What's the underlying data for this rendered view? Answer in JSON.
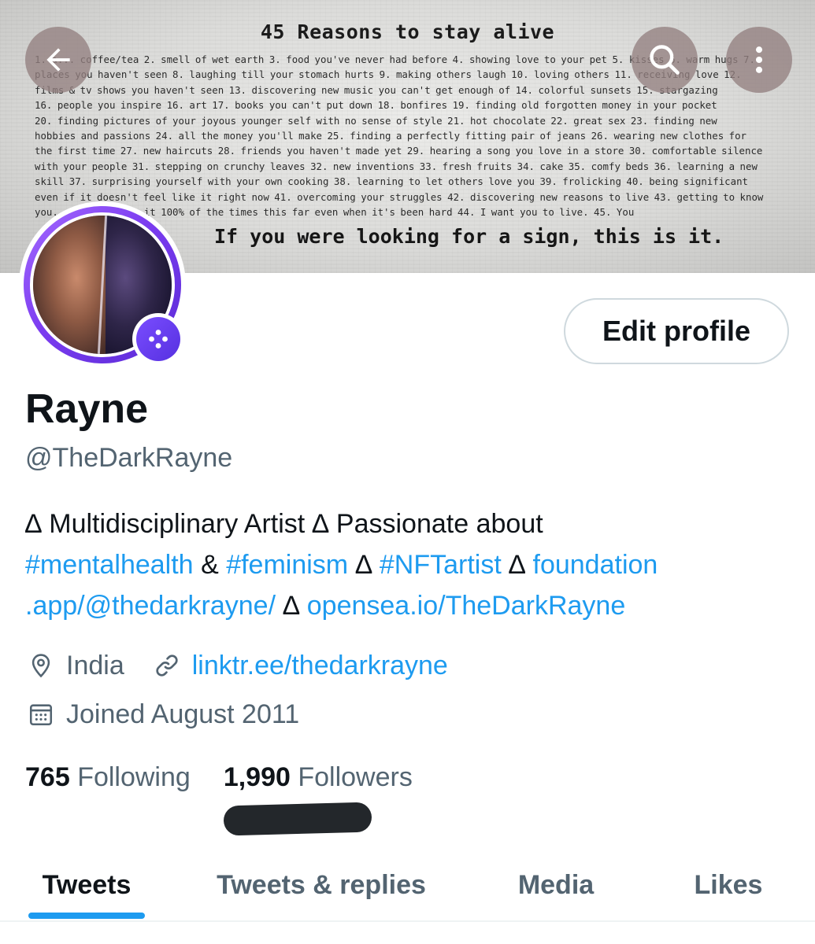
{
  "banner": {
    "title": "45 Reasons to stay alive",
    "body": "1. a... coffee/tea 2. smell of wet earth 3. food you've never had before 4. showing love to your pet 5. kisses 6. warm hugs 7.\nplaces you haven't seen 8. laughing till your stomach hurts 9. making others laugh 10. loving others 11. receiving love 12.\nfilms & tv shows you haven't seen 13. discovering new music you can't get enough of 14. colorful sunsets 15. stargazing\n16. people you inspire 16. art 17. books you can't put down 18. bonfires 19. finding old forgotten money in your pocket\n20. finding pictures of your joyous younger self with no sense of style 21. hot chocolate 22. great sex 23. finding new\nhobbies and passions 24. all the money you'll make 25. finding a perfectly fitting pair of jeans 26. wearing new clothes for\nthe first time 27. new haircuts 28. friends you haven't made yet 29. hearing a song you love in a store 30. comfortable silence\nwith your people 31. stepping on crunchy leaves 32. new inventions 33. fresh fruits 34. cake 35. comfy beds 36. learning a new\nskill 37. surprising yourself with your own cooking 38. learning to let others love you 39. frolicking 40. being significant\neven if it doesn't feel like it right now 41. overcoming your struggles 42. discovering new reasons to live 43. getting to know\nyou... having made it 100% of the times this far even when it's been hard 44. I want you to live. 45. You",
    "sign": "If you were looking for a sign, this is it.",
    "back_icon": "arrow-left-icon",
    "search_icon": "search-icon",
    "more_icon": "more-vertical-icon"
  },
  "profile": {
    "avatar_badge_icon": "nft-hexagon-icon",
    "edit_label": "Edit profile",
    "name": "Rayne",
    "handle": "@TheDarkRayne",
    "bio": {
      "line1": "∆ Multidisciplinary Artist ∆ Passionate about",
      "tag1": "#mentalhealth",
      "amp": "&",
      "tag2": "#feminism",
      "sep1": "∆",
      "tag3": "#NFTartist",
      "sep2": "∆",
      "link1a": "foundation",
      "link1b": ".app/@thedarkrayne/",
      "sep3": "∆",
      "link2": "opensea.io/TheDarkRayne"
    },
    "location": "India",
    "website": "linktr.ee/thedarkrayne",
    "joined": "Joined August 2011",
    "following_count": "765",
    "following_label": "Following",
    "followers_count": "1,990",
    "followers_label": "Followers"
  },
  "tabs": [
    {
      "label": "Tweets",
      "active": true
    },
    {
      "label": "Tweets & replies",
      "active": false
    },
    {
      "label": "Media",
      "active": false
    },
    {
      "label": "Likes",
      "active": false
    }
  ],
  "colors": {
    "accent": "#1d9bf0",
    "text_primary": "#0f1419",
    "text_secondary": "#536471",
    "nft_purple": "#6b3cf0"
  }
}
